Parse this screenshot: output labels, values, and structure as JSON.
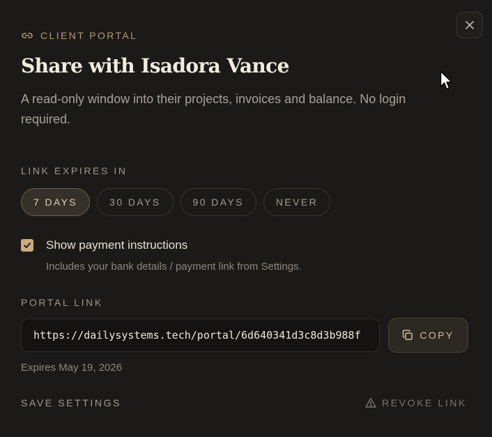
{
  "header": {
    "eyebrow": "CLIENT PORTAL",
    "eyebrow_icon": "link-icon",
    "title": "Share with Isadora Vance",
    "subtitle": "A read-only window into their projects, invoices and balance. No login required."
  },
  "expiry": {
    "label": "LINK EXPIRES IN",
    "options": [
      "7 DAYS",
      "30 DAYS",
      "90 DAYS",
      "NEVER"
    ],
    "selected": "7 DAYS"
  },
  "payment_instructions": {
    "checked": true,
    "label": "Show payment instructions",
    "help": "Includes your bank details / payment link from Settings."
  },
  "portal_link": {
    "label": "PORTAL LINK",
    "url": "https://dailysystems.tech/portal/6d640341d3c8d3b988f",
    "copy_label": "COPY",
    "expires_text": "Expires May 19, 2026"
  },
  "footer": {
    "save_label": "SAVE SETTINGS",
    "revoke_label": "REVOKE LINK",
    "revoke_icon": "warning-icon"
  },
  "colors": {
    "background": "#1c1a18",
    "accent": "#c9ad7f",
    "eyebrow": "#b39a6c"
  }
}
